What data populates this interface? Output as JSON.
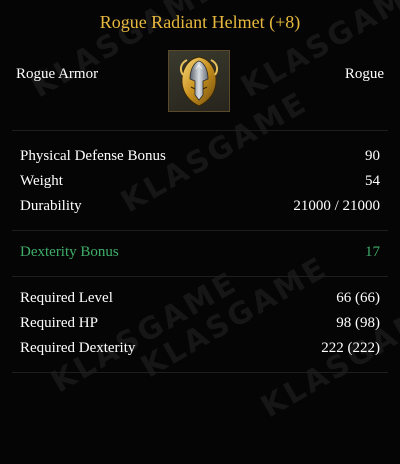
{
  "item": {
    "name": "Rogue Radiant Helmet (+8)",
    "category": "Rogue Armor",
    "class": "Rogue",
    "icon": "golden-helmet-icon"
  },
  "stats": [
    {
      "label": "Physical Defense Bonus",
      "value": "90"
    },
    {
      "label": "Weight",
      "value": "54"
    },
    {
      "label": "Durability",
      "value": "21000 / 21000"
    }
  ],
  "bonuses": [
    {
      "label": "Dexterity Bonus",
      "value": "17"
    }
  ],
  "requirements": [
    {
      "label": "Required Level",
      "value": "66 (66)"
    },
    {
      "label": "Required HP",
      "value": "98 (98)"
    },
    {
      "label": "Required Dexterity",
      "value": "222 (222)"
    }
  ],
  "watermark": "KLASGAME",
  "colors": {
    "title": "#e8b93e",
    "text": "#ffffff",
    "bonus": "#3fae6a",
    "background": "#050505"
  }
}
